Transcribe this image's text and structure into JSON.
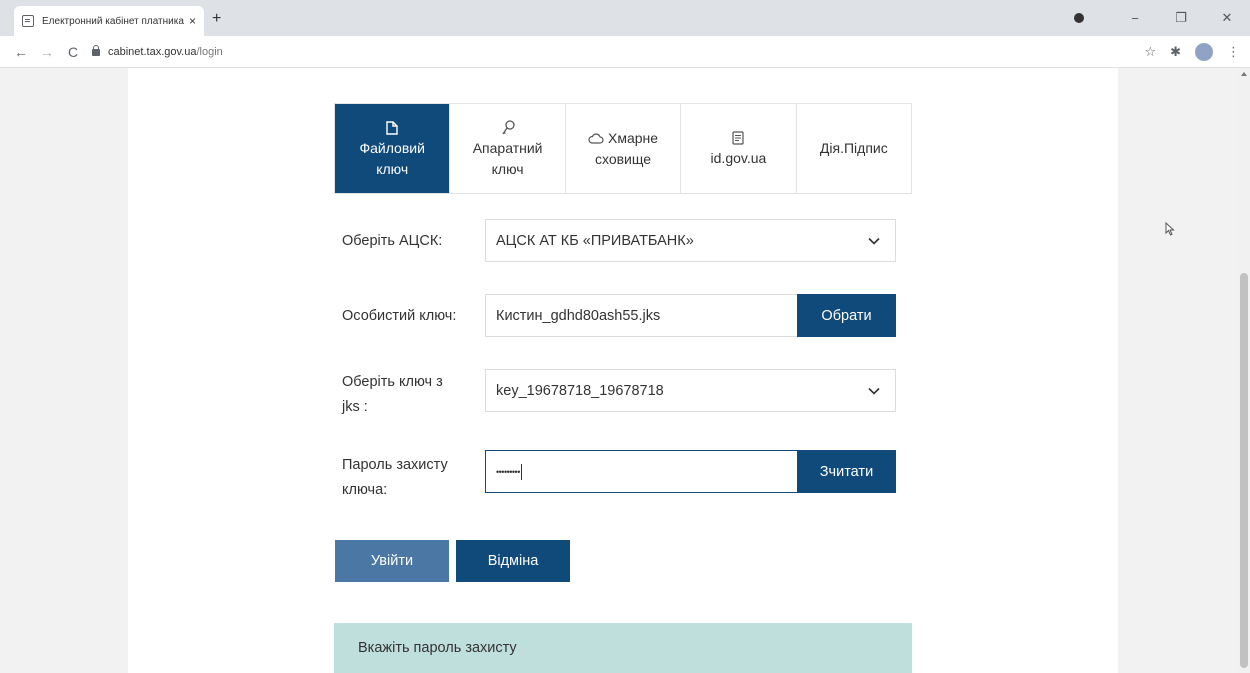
{
  "browser": {
    "tab_title": "Електронний кабінет платника",
    "tab_close": "×",
    "new_tab": "+",
    "url_host": "cabinet.tax.gov.ua",
    "url_path": "/login",
    "win_minimize": "−",
    "win_maximize": "❐",
    "win_close": "✕"
  },
  "login": {
    "tabs": [
      {
        "line1": "Файловий",
        "line2": "ключ",
        "icon": "file-icon",
        "active": true
      },
      {
        "line1": "Апаратний",
        "line2": "ключ",
        "icon": "key-icon",
        "active": false
      },
      {
        "line1": "Хмарне",
        "line2": "сховище",
        "icon": "cloud-icon",
        "active": false
      },
      {
        "line1": "id.gov.ua",
        "icon": "document-icon",
        "active": false
      },
      {
        "line1": "Дія.Підпис",
        "active": false
      }
    ],
    "acsk_label": "Оберіть АЦСК:",
    "acsk_value": "АЦСК АТ КБ «ПРИВАТБАНК»",
    "key_label": "Особистий ключ:",
    "key_value": "Кистин_gdhd80ash55.jks",
    "choose_button": "Обрати",
    "jks_label_line1": "Оберіть ключ з",
    "jks_label_line2": "jks :",
    "jks_value": "key_19678718_19678718",
    "password_label_line1": "Пароль захисту",
    "password_label_line2": "ключа:",
    "password_value": "•••••••••",
    "read_button": "Зчитати",
    "enter_button": "Увійти",
    "cancel_button": "Відміна",
    "alert_message": "Вкажіть пароль захисту"
  },
  "colors": {
    "primary": "#104a7a",
    "primary_light": "#4a77a3",
    "alert_bg": "#bfdfdd"
  }
}
